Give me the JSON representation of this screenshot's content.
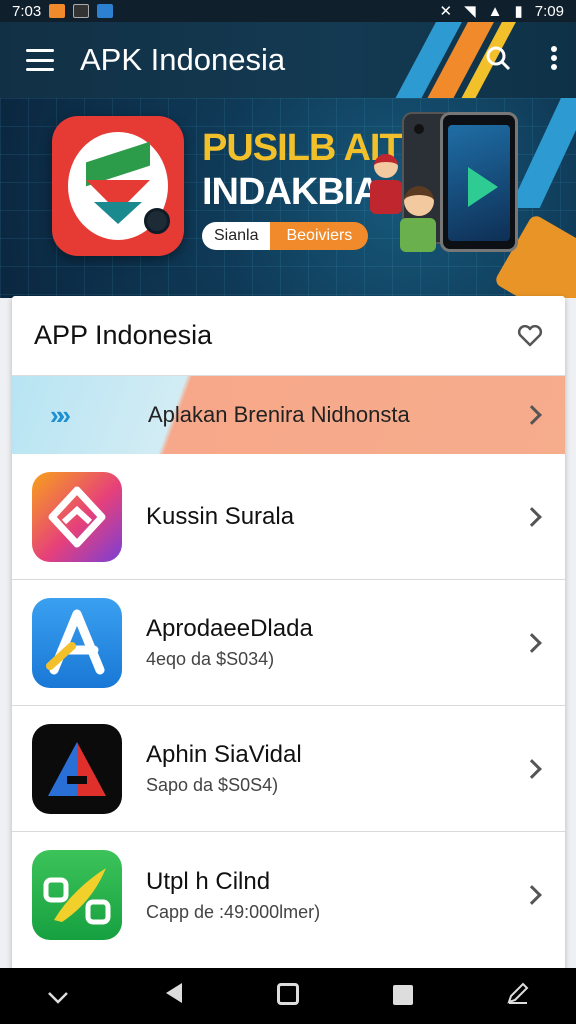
{
  "status_bar": {
    "time_left": "7:03",
    "time_right": "7:09"
  },
  "app_bar": {
    "title": "APK Indonesia"
  },
  "banner": {
    "headline_1": "PUSILB AIT",
    "headline_2": "INDAKBIA",
    "pill_left": "Sianla",
    "pill_right": "Beoiviers"
  },
  "card": {
    "title": "APP Indonesia",
    "promo": {
      "arrows": "»»",
      "label": "Aplakan Brenira Nidhonsta"
    },
    "rows": [
      {
        "title": "Kussin Surala",
        "subtitle": ""
      },
      {
        "title": "AprodaeeDlada",
        "subtitle": "4eqo da $S034)"
      },
      {
        "title": "Aphin SiaVidal",
        "subtitle": "Sapo da $S0S4)"
      },
      {
        "title": "Utpl h Cilnd",
        "subtitle": "Capp de :49:000lmer)"
      }
    ]
  },
  "colors": {
    "app_bar": "#123045",
    "accent_orange": "#f08a2b",
    "promo_blue": "#b7e4f3",
    "promo_orange": "#f6ad8c"
  }
}
